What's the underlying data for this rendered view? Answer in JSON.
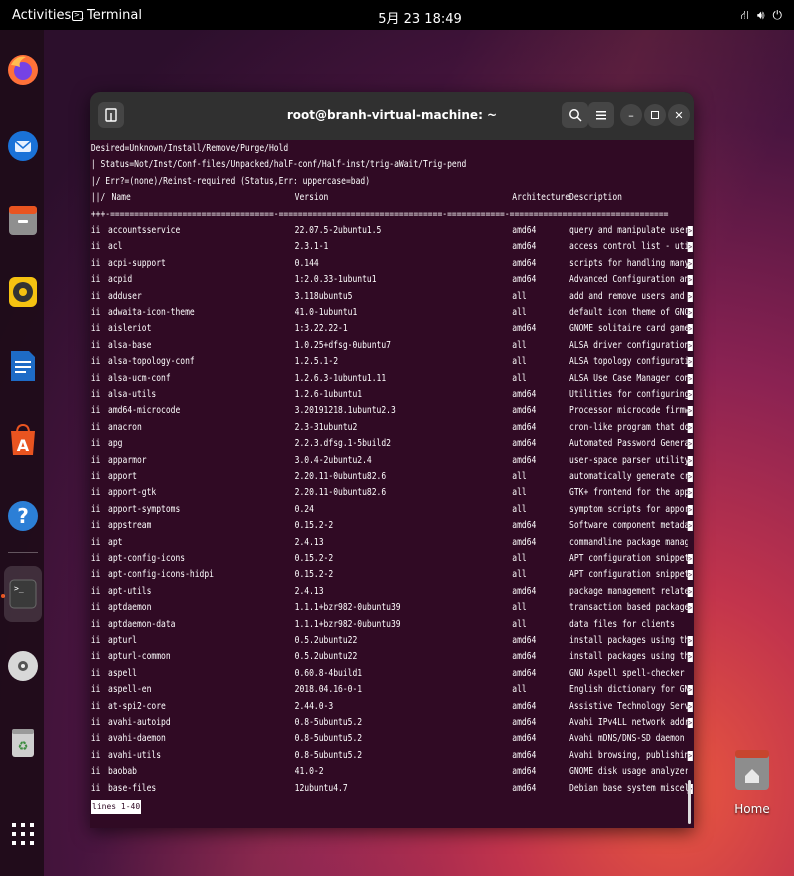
{
  "topbar": {
    "activities": "Activities",
    "app_name": "Terminal",
    "clock": "5月 23 18:49"
  },
  "dock": {
    "items": [
      {
        "name": "firefox"
      },
      {
        "name": "thunderbird"
      },
      {
        "name": "files"
      },
      {
        "name": "rhythmbox"
      },
      {
        "name": "libreoffice-writer"
      },
      {
        "name": "app-center"
      },
      {
        "name": "help"
      },
      {
        "name": "terminal"
      },
      {
        "name": "dvd"
      },
      {
        "name": "trash"
      },
      {
        "name": "show-apps"
      }
    ]
  },
  "desktop": {
    "home_label": "Home"
  },
  "terminal": {
    "title": "root@branh-virtual-machine: ~",
    "header_lines": [
      "Desired=Unknown/Install/Remove/Purge/Hold",
      "| Status=Not/Inst/Conf-files/Unpacked/halF-conf/Half-inst/trig-aWait/Trig-pend",
      "|/ Err?=(none)/Reinst-required (Status,Err: uppercase=bad)"
    ],
    "columns": {
      "status": "||/",
      "name": "Name",
      "version": "Version",
      "arch": "Architecture",
      "desc": "Description"
    },
    "separator": "+++-==================================-==================================-============-=================================",
    "rows": [
      [
        "ii",
        "accountsservice",
        "22.07.5-2ubuntu1.5",
        "amd64",
        "query and manipulate user",
        "1"
      ],
      [
        "ii",
        "acl",
        "2.3.1-1",
        "amd64",
        "access control list - util",
        "1"
      ],
      [
        "ii",
        "acpi-support",
        "0.144",
        "amd64",
        "scripts for handling many",
        "1"
      ],
      [
        "ii",
        "acpid",
        "1:2.0.33-1ubuntu1",
        "amd64",
        "Advanced Configuration and",
        "1"
      ],
      [
        "ii",
        "adduser",
        "3.118ubuntu5",
        "all",
        "add and remove users and g",
        "1"
      ],
      [
        "ii",
        "adwaita-icon-theme",
        "41.0-1ubuntu1",
        "all",
        "default icon theme of GNOM",
        "1"
      ],
      [
        "ii",
        "aisleriot",
        "1:3.22.22-1",
        "amd64",
        "GNOME solitaire card game",
        "1"
      ],
      [
        "ii",
        "alsa-base",
        "1.0.25+dfsg-0ubuntu7",
        "all",
        "ALSA driver configuration",
        "1"
      ],
      [
        "ii",
        "alsa-topology-conf",
        "1.2.5.1-2",
        "all",
        "ALSA topology configuratio",
        "1"
      ],
      [
        "ii",
        "alsa-ucm-conf",
        "1.2.6.3-1ubuntu1.11",
        "all",
        "ALSA Use Case Manager conf",
        "1"
      ],
      [
        "ii",
        "alsa-utils",
        "1.2.6-1ubuntu1",
        "amd64",
        "Utilities for configuring",
        "1"
      ],
      [
        "ii",
        "amd64-microcode",
        "3.20191218.1ubuntu2.3",
        "amd64",
        "Processor microcode firmwa",
        "1"
      ],
      [
        "ii",
        "anacron",
        "2.3-31ubuntu2",
        "amd64",
        "cron-like program that doe",
        "1"
      ],
      [
        "ii",
        "apg",
        "2.2.3.dfsg.1-5build2",
        "amd64",
        "Automated Password Generat",
        "1"
      ],
      [
        "ii",
        "apparmor",
        "3.0.4-2ubuntu2.4",
        "amd64",
        "user-space parser utility",
        "1"
      ],
      [
        "ii",
        "apport",
        "2.20.11-0ubuntu82.6",
        "all",
        "automatically generate cra",
        "1"
      ],
      [
        "ii",
        "apport-gtk",
        "2.20.11-0ubuntu82.6",
        "all",
        "GTK+ frontend for the appo",
        "1"
      ],
      [
        "ii",
        "apport-symptoms",
        "0.24",
        "all",
        "symptom scripts for apport",
        "1"
      ],
      [
        "ii",
        "appstream",
        "0.15.2-2",
        "amd64",
        "Software component metadat",
        "1"
      ],
      [
        "ii",
        "apt",
        "2.4.13",
        "amd64",
        "commandline package manager",
        "0"
      ],
      [
        "ii",
        "apt-config-icons",
        "0.15.2-2",
        "all",
        "APT configuration snippet",
        "1"
      ],
      [
        "ii",
        "apt-config-icons-hidpi",
        "0.15.2-2",
        "all",
        "APT configuration snippet",
        "1"
      ],
      [
        "ii",
        "apt-utils",
        "2.4.13",
        "amd64",
        "package management related",
        "1"
      ],
      [
        "ii",
        "aptdaemon",
        "1.1.1+bzr982-0ubuntu39",
        "all",
        "transaction based package",
        "1"
      ],
      [
        "ii",
        "aptdaemon-data",
        "1.1.1+bzr982-0ubuntu39",
        "all",
        "data files for clients",
        "0"
      ],
      [
        "ii",
        "apturl",
        "0.5.2ubuntu22",
        "amd64",
        "install packages using the",
        "1"
      ],
      [
        "ii",
        "apturl-common",
        "0.5.2ubuntu22",
        "amd64",
        "install packages using the",
        "1"
      ],
      [
        "ii",
        "aspell",
        "0.60.8-4build1",
        "amd64",
        "GNU Aspell spell-checker",
        "0"
      ],
      [
        "ii",
        "aspell-en",
        "2018.04.16-0-1",
        "all",
        "English dictionary for GNU",
        "1"
      ],
      [
        "ii",
        "at-spi2-core",
        "2.44.0-3",
        "amd64",
        "Assistive Technology Servi",
        "1"
      ],
      [
        "ii",
        "avahi-autoipd",
        "0.8-5ubuntu5.2",
        "amd64",
        "Avahi IPv4LL network addre",
        "1"
      ],
      [
        "ii",
        "avahi-daemon",
        "0.8-5ubuntu5.2",
        "amd64",
        "Avahi mDNS/DNS-SD daemon",
        "0"
      ],
      [
        "ii",
        "avahi-utils",
        "0.8-5ubuntu5.2",
        "amd64",
        "Avahi browsing, publishing",
        "1"
      ],
      [
        "ii",
        "baobab",
        "41.0-2",
        "amd64",
        "GNOME disk usage analyzer",
        "0"
      ],
      [
        "ii",
        "base-files",
        "12ubuntu4.7",
        "amd64",
        "Debian base system miscell",
        "1"
      ]
    ],
    "status_line": "lines 1-40"
  }
}
